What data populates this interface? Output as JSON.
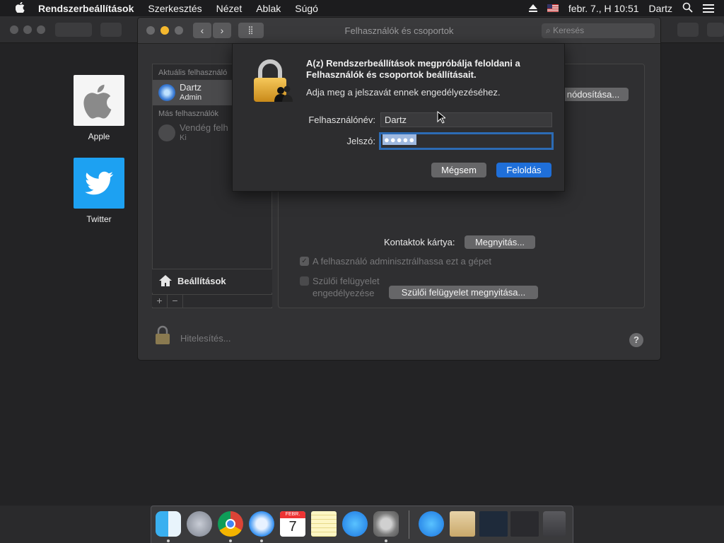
{
  "menubar": {
    "app_name": "Rendszerbeállítások",
    "menus": [
      "Szerkesztés",
      "Nézet",
      "Ablak",
      "Súgó"
    ],
    "datetime": "febr. 7., H 10:51",
    "user": "Dartz"
  },
  "desktop": {
    "icons": [
      {
        "label": "Apple"
      },
      {
        "label": "Twitter"
      }
    ]
  },
  "window": {
    "title": "Felhasználók és csoportok",
    "search_placeholder": "Keresés",
    "sidebar": {
      "current_users_header": "Aktuális felhasználó",
      "current_user": {
        "name": "Dartz",
        "role": "Admin"
      },
      "other_users_header": "Más felhasználók",
      "guest_user": {
        "name": "Vendég felh",
        "status": "Ki"
      },
      "settings_label": "Beállítások",
      "add_symbol": "+",
      "remove_symbol": "−"
    },
    "content": {
      "change_button_partial": "nódosítása...",
      "contacts_card_label": "Kontaktok kártya:",
      "open_button": "Megnyitás...",
      "admin_checkbox_label": "A felhasználó adminisztrálhassa ezt a gépet",
      "admin_checkbox_checked": true,
      "parental_checkbox_label_1": "Szülői felügyelet",
      "parental_checkbox_label_2": "engedélyezése",
      "parental_checkbox_checked": false,
      "parental_button": "Szülői felügyelet megnyitása..."
    },
    "lock_label": "Hitelesítés...",
    "help_symbol": "?"
  },
  "dialog": {
    "message_bold": "A(z) Rendszerbeállítások megpróbálja feloldani a Felhasználók és csoportok beállításait.",
    "message": "Adja meg a jelszavát ennek engedélyezéséhez.",
    "username_label": "Felhasználónév:",
    "username_value": "Dartz",
    "password_label": "Jelszó:",
    "password_value": "●●●●●",
    "cancel_button": "Mégsem",
    "unlock_button": "Feloldás"
  },
  "dock": {
    "calendar_month": "FEBR.",
    "calendar_day": "7"
  },
  "colors": {
    "accent": "#2c6bb5",
    "unlock_button": "#1f6fd9",
    "twitter": "#1da1f2"
  }
}
